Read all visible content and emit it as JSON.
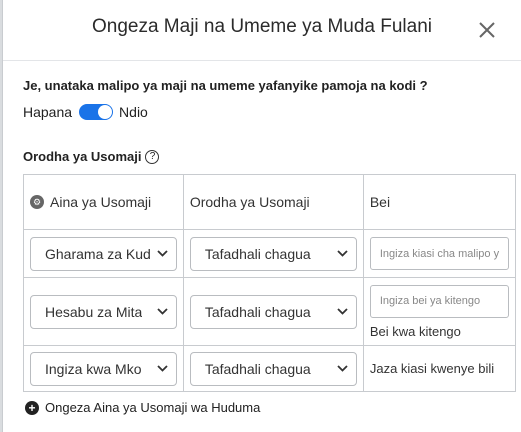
{
  "modal": {
    "title": "Ongeza Maji na Umeme ya Muda Fulani"
  },
  "question": "Je, unataka malipo ya maji na umeme yafanyike pamoja na kodi ?",
  "toggle": {
    "off_label": "Hapana",
    "on_label": "Ndio",
    "state": "on"
  },
  "section_title": "Orodha ya Usomaji",
  "table": {
    "headers": [
      "Aina ya Usomaji",
      "Orodha ya Usomaji",
      "Bei"
    ],
    "rows": [
      {
        "type_value": "Gharama za Kud",
        "list_value": "Tafadhali chagua",
        "price_placeholder": "Ingiza kiasi cha malipo y"
      },
      {
        "type_value": "Hesabu za Mita",
        "list_value": "Tafadhali chagua",
        "price_placeholder": "Ingiza bei ya kitengo",
        "price_note": "Bei kwa kitengo"
      },
      {
        "type_value": "Ingiza kwa Mko",
        "list_value": "Tafadhali chagua",
        "price_text": "Jaza kiasi kwenye bili"
      }
    ]
  },
  "add_link": "Ongeza Aina ya Usomaji wa Huduma",
  "colors": {
    "toggle": "#1a73e8",
    "border": "#c8cbcf"
  }
}
